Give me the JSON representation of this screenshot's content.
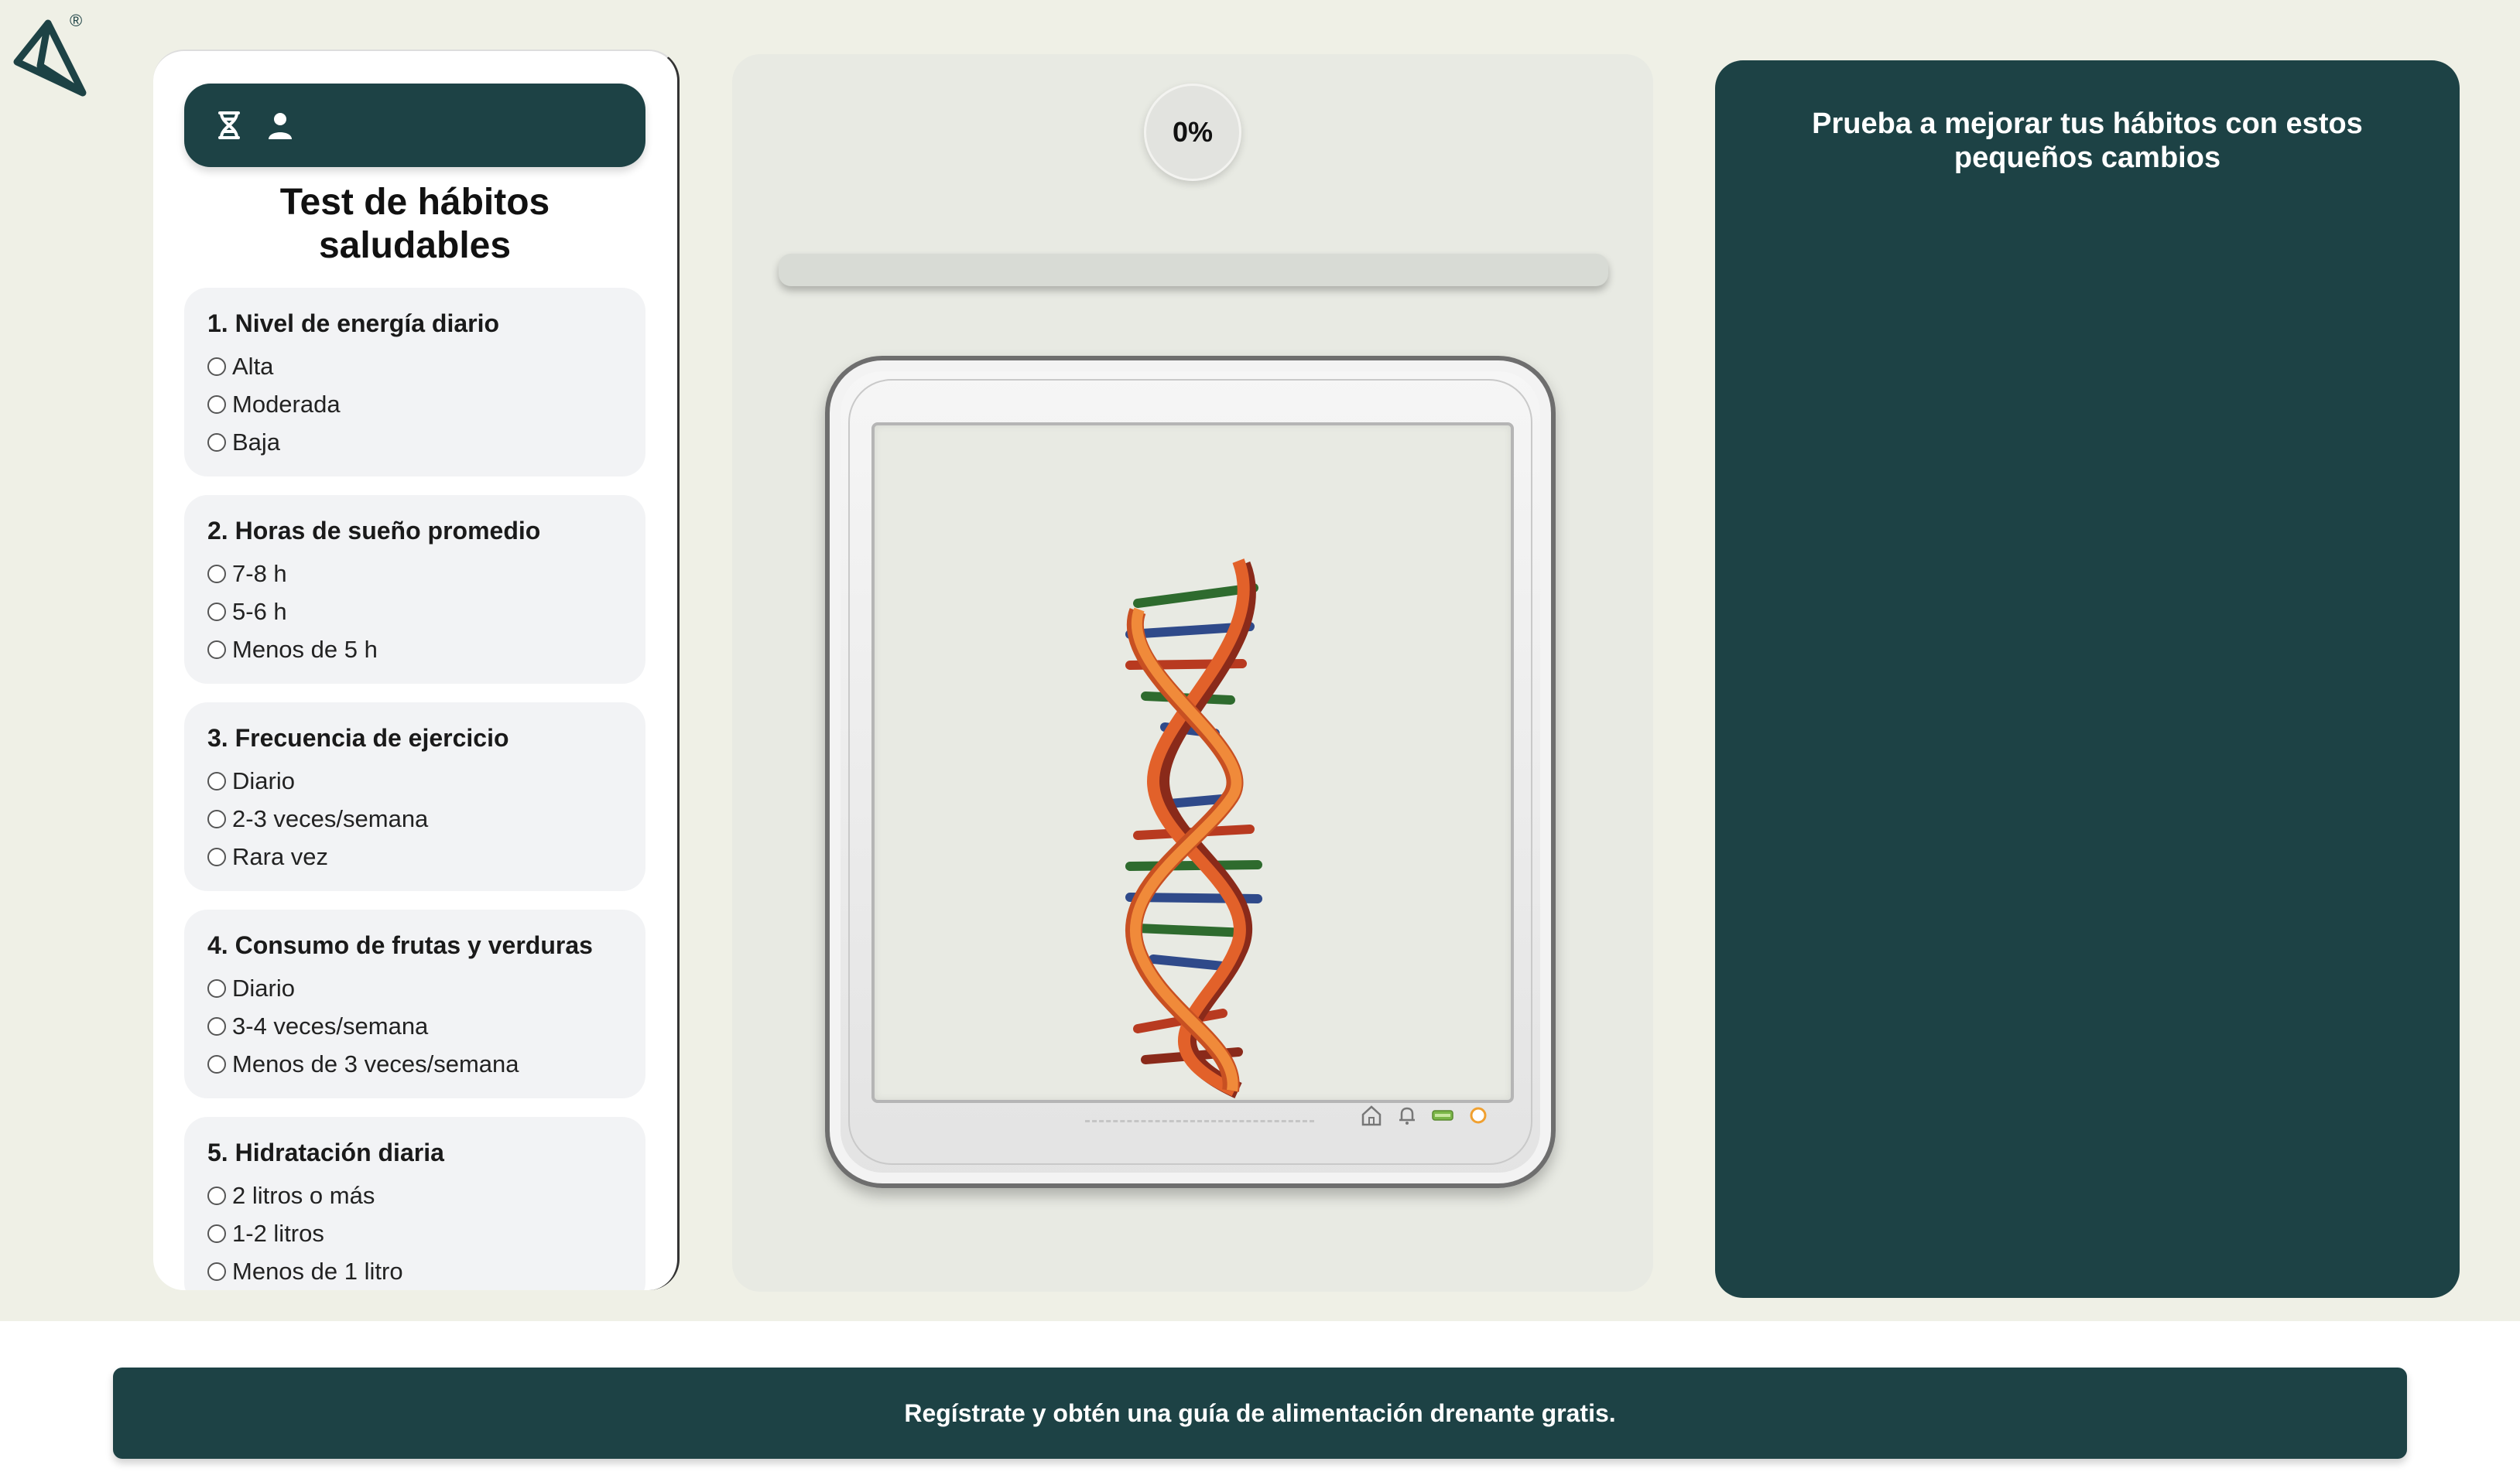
{
  "brand": {
    "registered_mark": "®"
  },
  "quiz": {
    "toolbar_icons": [
      "dna-icon",
      "user-icon"
    ],
    "title": "Test de hábitos saludables",
    "questions": [
      {
        "title": "1. Nivel de energía diario",
        "options": [
          "Alta",
          "Moderada",
          "Baja"
        ]
      },
      {
        "title": "2. Horas de sueño promedio",
        "options": [
          "7-8 h",
          "5-6 h",
          "Menos de 5 h"
        ]
      },
      {
        "title": "3. Frecuencia de ejercicio",
        "options": [
          "Diario",
          "2-3 veces/semana",
          "Rara vez"
        ]
      },
      {
        "title": "4. Consumo de frutas y verduras",
        "options": [
          "Diario",
          "3-4 veces/semana",
          "Menos de 3 veces/semana"
        ]
      },
      {
        "title": "5. Hidratación diaria",
        "options": [
          "2 litros o más",
          "1-2 litros",
          "Menos de 1 litro"
        ]
      }
    ]
  },
  "progress": {
    "label": "0%",
    "fraction": 0
  },
  "tips": {
    "title": "Prueba a mejorar tus hábitos con estos pequeños cambios"
  },
  "banner": {
    "text": "Regístrate y obtén una guía de alimentación drenante gratis."
  },
  "colors": {
    "primary": "#1d4245",
    "background": "#eff0e6",
    "card": "#f2f3f5"
  }
}
